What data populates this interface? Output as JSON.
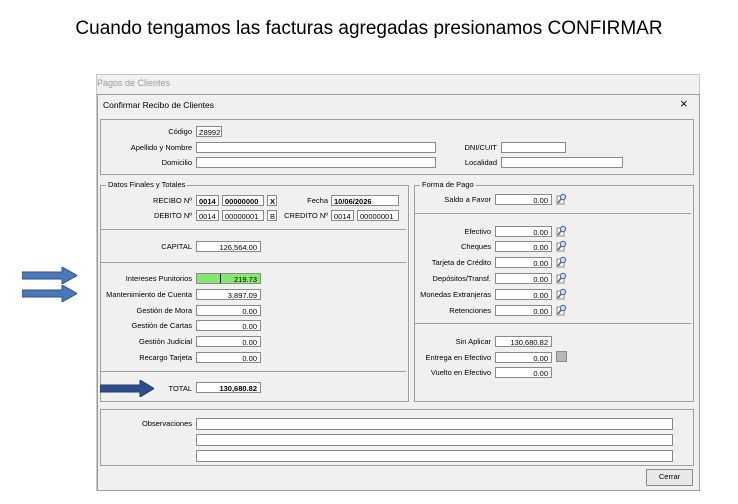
{
  "instruction": "Cuando tengamos las facturas agregadas presionamos CONFIRMAR",
  "parent_window_title": "Pagos de Clientes",
  "dialog": {
    "title": "Confirmar Recibo de Clientes",
    "close_glyph": "×"
  },
  "cliente": {
    "codigo_label": "Código",
    "codigo_value": "Z8992",
    "apellido_label": "Apellido y Nombre",
    "apellido_value": "",
    "domicilio_label": "Domicilio",
    "domicilio_value": "",
    "dni_label": "DNI/CUIT",
    "dni_value": "",
    "localidad_label": "Localidad",
    "localidad_value": ""
  },
  "datos_finales": {
    "group_label": "Datos Finales y Totales",
    "recibo_label": "RECIBO Nº",
    "recibo_pv": "0014",
    "recibo_num": "00000000",
    "recibo_letra": "X",
    "fecha_label": "Fecha",
    "fecha_value": "10/06/2026",
    "debito_label": "DEBITO Nº",
    "debito_pv": "0014",
    "debito_num": "00000001",
    "debito_letra": "B",
    "credito_label": "CREDITO Nº",
    "credito_pv": "0014",
    "credito_num": "00000001"
  },
  "capital": {
    "label": "CAPITAL",
    "value": "126,564.00"
  },
  "cargos": [
    {
      "label": "Intereses Punitorios",
      "value": "219.73"
    },
    {
      "label": "Mantenimiento de Cuenta",
      "value": "3,897.09"
    },
    {
      "label": "Gestión de Mora",
      "value": "0.00"
    },
    {
      "label": "Gestión de Cartas",
      "value": "0.00"
    },
    {
      "label": "Gestión Judicial",
      "value": "0.00"
    },
    {
      "label": "Recargo Tarjeta",
      "value": "0.00"
    }
  ],
  "total": {
    "label": "TOTAL",
    "value": "130,680.82"
  },
  "forma_pago": {
    "group_label": "Forma de Pago",
    "saldo_label": "Saldo a Favor",
    "saldo_value": "0.00",
    "medios": [
      {
        "label": "Efectivo",
        "value": "0.00"
      },
      {
        "label": "Cheques",
        "value": "0.00"
      },
      {
        "label": "Tarjeta de Crédito",
        "value": "0.00"
      },
      {
        "label": "Depósitos/Transf.",
        "value": "0.00"
      },
      {
        "label": "Monedas Extranjeras",
        "value": "0.00"
      },
      {
        "label": "Retenciones",
        "value": "0.00"
      }
    ],
    "sin_aplicar_label": "Sin Aplicar",
    "sin_aplicar_value": "130,680.82",
    "entrega_label": "Entrega en Efectivo",
    "entrega_value": "0.00",
    "vuelto_label": "Vuelto en Efectivo",
    "vuelto_value": "0.00"
  },
  "observaciones": {
    "label": "Observaciones",
    "line1": "",
    "line2": "",
    "line3": ""
  },
  "buttons": {
    "cerrar": "Cerrar"
  },
  "colors": {
    "arrow": "#4a78b8",
    "arrow_dark": "#2e4f8c",
    "highlight": "#86e86c"
  }
}
